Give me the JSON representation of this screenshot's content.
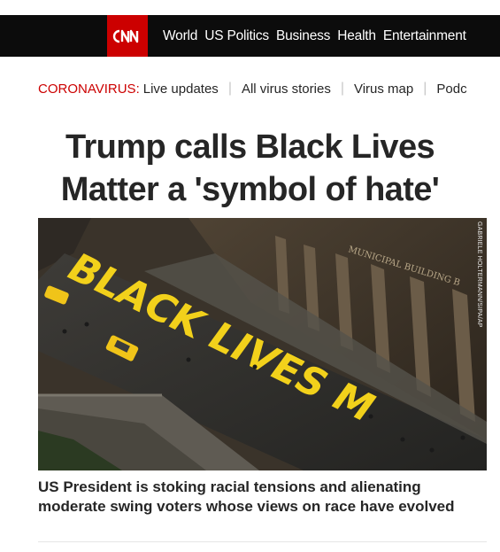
{
  "header": {
    "logo_text": "CNN",
    "nav": [
      "World",
      "US Politics",
      "Business",
      "Health",
      "Entertainment"
    ]
  },
  "ticker": {
    "label": "CORONAVIRUS:",
    "links": [
      "Live updates",
      "All virus stories",
      "Virus map",
      "Podc"
    ]
  },
  "article": {
    "headline_line1": "Trump calls Black Lives",
    "headline_line2": "Matter a 'symbol of hate'",
    "photo_credit": "GABRIELE HOLTERMANN/SIPA/AP",
    "photo_building_inscription": "MUNICIPAL BUILDING B",
    "photo_street_text": "BLACK LIVES M",
    "dek": "US President is stoking racial tensions and alienating moderate swing voters whose views on race have evolved"
  },
  "colors": {
    "brand_red": "#cc0000",
    "nav_bg": "#0c0c0c",
    "text": "#262626",
    "mural_yellow": "#f2d11b"
  }
}
